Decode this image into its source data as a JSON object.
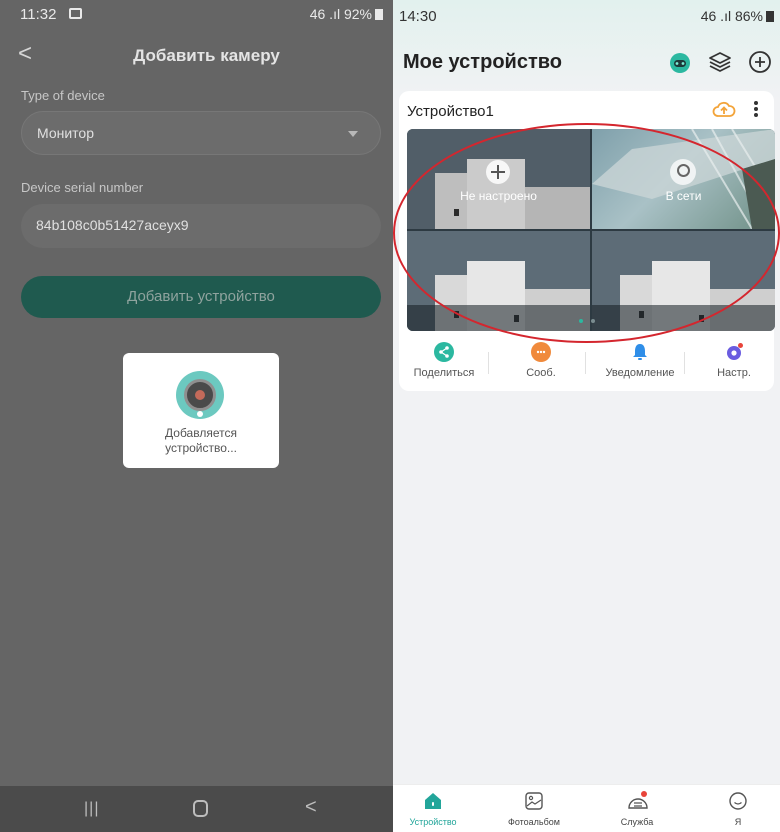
{
  "left_screen": {
    "status": {
      "time": "11:32",
      "signal": "46 .ıl",
      "battery": "92%"
    },
    "header": {
      "back": "<",
      "title": "Добавить камеру"
    },
    "device_type": {
      "label": "Type of device",
      "value": "Монитор"
    },
    "serial": {
      "label": "Device serial number",
      "value": "84b108c0b51427aceyx9"
    },
    "add_button": "Добавить устройство",
    "dialog": {
      "line1": "Добавляется",
      "line2": "устройство..."
    },
    "nav": {
      "recent": "|||",
      "back": "<"
    }
  },
  "right_screen": {
    "status": {
      "time": "14:30",
      "signal": "46 .ıl",
      "battery": "86%"
    },
    "header": {
      "title": "Мое устройство",
      "icons": [
        "support-icon",
        "layers-icon",
        "add-circle-icon"
      ]
    },
    "device": {
      "name": "Устройство1",
      "channels": [
        {
          "label": "Не настроено",
          "state": "not-configured"
        },
        {
          "label": "В сети",
          "state": "online"
        },
        {
          "label": "",
          "state": "preview"
        },
        {
          "label": "",
          "state": "preview"
        }
      ],
      "actions": [
        {
          "label": "Поделиться",
          "icon": "share-icon",
          "color": "#2bb8a0"
        },
        {
          "label": "Сооб.",
          "icon": "message-icon",
          "color": "#f08a3c"
        },
        {
          "label": "Уведомление",
          "icon": "bell-icon",
          "color": "#2f8ee8"
        },
        {
          "label": "Настр.",
          "icon": "settings-icon",
          "color": "#6a5ce0"
        }
      ]
    },
    "tabs": [
      {
        "label": "Устройство",
        "icon": "home-icon",
        "active": true
      },
      {
        "label": "Фотоальбом",
        "icon": "photo-icon",
        "active": false
      },
      {
        "label": "Служба",
        "icon": "service-icon",
        "active": false
      },
      {
        "label": "Я",
        "icon": "smile-icon",
        "active": false
      }
    ],
    "colors": {
      "accent": "#22a59a",
      "annotation": "#d4262e",
      "upload": "#f3a43a",
      "notify_dot": "#e8443a"
    }
  }
}
